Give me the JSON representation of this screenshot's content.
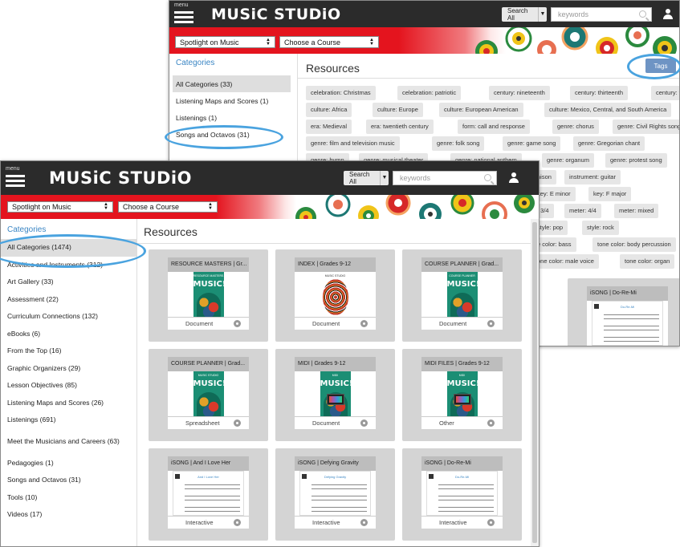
{
  "back_window": {
    "header": {
      "menu_label": "menu",
      "logo": "MUSiC STUDiO",
      "search_scope": "Search All",
      "search_placeholder": "keywords"
    },
    "band": {
      "program": "Spotlight on Music",
      "course": "Choose a Course"
    },
    "sidebar": {
      "title": "Categories",
      "items": [
        {
          "label": "All Categories (33)"
        },
        {
          "label": "Listening Maps and Scores (1)"
        },
        {
          "label": "Listenings (1)"
        },
        {
          "label": "Songs and Octavos (31)"
        }
      ]
    },
    "main": {
      "title": "Resources",
      "tags_button": "Tags",
      "tags": [
        "celebration: Christmas",
        "celebration: patriotic",
        "century: nineteenth",
        "century: thirteenth",
        "century: twentieth",
        "culture: Africa",
        "culture: Europe",
        "culture: European American",
        "culture: Mexico, Central, and South America",
        "era: Medieval",
        "era: twentieth century",
        "form: call and response",
        "genre: chorus",
        "genre: Civil Rights song",
        "genre: film and television music",
        "genre: folk song",
        "genre: game song",
        "genre: Gregorian chant",
        "genre: hymn",
        "genre: musical theater",
        "genre: national anthem",
        "genre: organum",
        "genre: protest song",
        "nison",
        "instrument: guitar",
        "key: E minor",
        "key: F major",
        ": 3/4",
        "meter: 4/4",
        "meter: mixed",
        "style: pop",
        "style: rock",
        "e color: bass",
        "tone color: body percussion",
        "one color: male voice",
        "tone color: organ"
      ],
      "visible_card": {
        "title": "iSONG | Do-Re-Mi",
        "sheet_title": "Do-Re-Mi"
      }
    }
  },
  "front_window": {
    "header": {
      "menu_label": "menu",
      "logo": "MUSiC STUDiO",
      "search_scope": "Search All",
      "search_placeholder": "keywords"
    },
    "band": {
      "program": "Spotlight on Music",
      "course": "Choose a Course"
    },
    "sidebar": {
      "title": "Categories",
      "items": [
        {
          "label": "All Categories (1474)"
        },
        {
          "label": "Activities and Instruments (312)"
        },
        {
          "label": "Art Gallery (33)"
        },
        {
          "label": "Assessment (22)"
        },
        {
          "label": "Curriculum Connections (132)"
        },
        {
          "label": "eBooks (6)"
        },
        {
          "label": "From the Top (16)"
        },
        {
          "label": "Graphic Organizers (29)"
        },
        {
          "label": "Lesson Objectives (85)"
        },
        {
          "label": "Listening Maps and Scores (26)"
        },
        {
          "label": "Listenings (691)"
        },
        {
          "label": "Meet the Musicians and Careers (63)"
        },
        {
          "label": "Pedagogies (1)"
        },
        {
          "label": "Songs and Octavos (31)"
        },
        {
          "label": "Tools (10)"
        },
        {
          "label": "Videos (17)"
        }
      ]
    },
    "main": {
      "title": "Resources",
      "cards": [
        {
          "title": "RESOURCE MASTERS | Gr...",
          "type": "Document",
          "thumb": "book",
          "book_head": "RESOURCE MASTERS"
        },
        {
          "title": "INDEX | Grades 9-12",
          "type": "Document",
          "thumb": "index",
          "book_head": "MUSIC STUDIO"
        },
        {
          "title": "COURSE PLANNER | Grad...",
          "type": "Document",
          "thumb": "book",
          "book_head": "COURSE PLANNER"
        },
        {
          "title": "COURSE PLANNER | Grad...",
          "type": "Spreadsheet",
          "thumb": "book",
          "book_head": "MUSIC STUDIO"
        },
        {
          "title": "MIDI | Grades 9-12",
          "type": "Document",
          "thumb": "book-screen",
          "book_head": "MIDI"
        },
        {
          "title": "MIDI FILES | Grades 9-12",
          "type": "Other",
          "thumb": "book-screen",
          "book_head": "MIDI"
        },
        {
          "title": "iSONG | And I Love Her",
          "type": "Interactive",
          "thumb": "sheet",
          "sheet_title": "And I Love Her"
        },
        {
          "title": "iSONG | Defying Gravity",
          "type": "Interactive",
          "thumb": "sheet",
          "sheet_title": "Defying Gravity"
        },
        {
          "title": "iSONG | Do-Re-Mi",
          "type": "Interactive",
          "thumb": "sheet",
          "sheet_title": "Do-Re-Mi"
        }
      ],
      "book_title": "MUSIC!"
    }
  },
  "colors": {
    "accent_red": "#e4141e",
    "link_blue": "#3b86c4",
    "highlight_oval": "#4aa3df",
    "header_dark": "#2b2b2b"
  }
}
